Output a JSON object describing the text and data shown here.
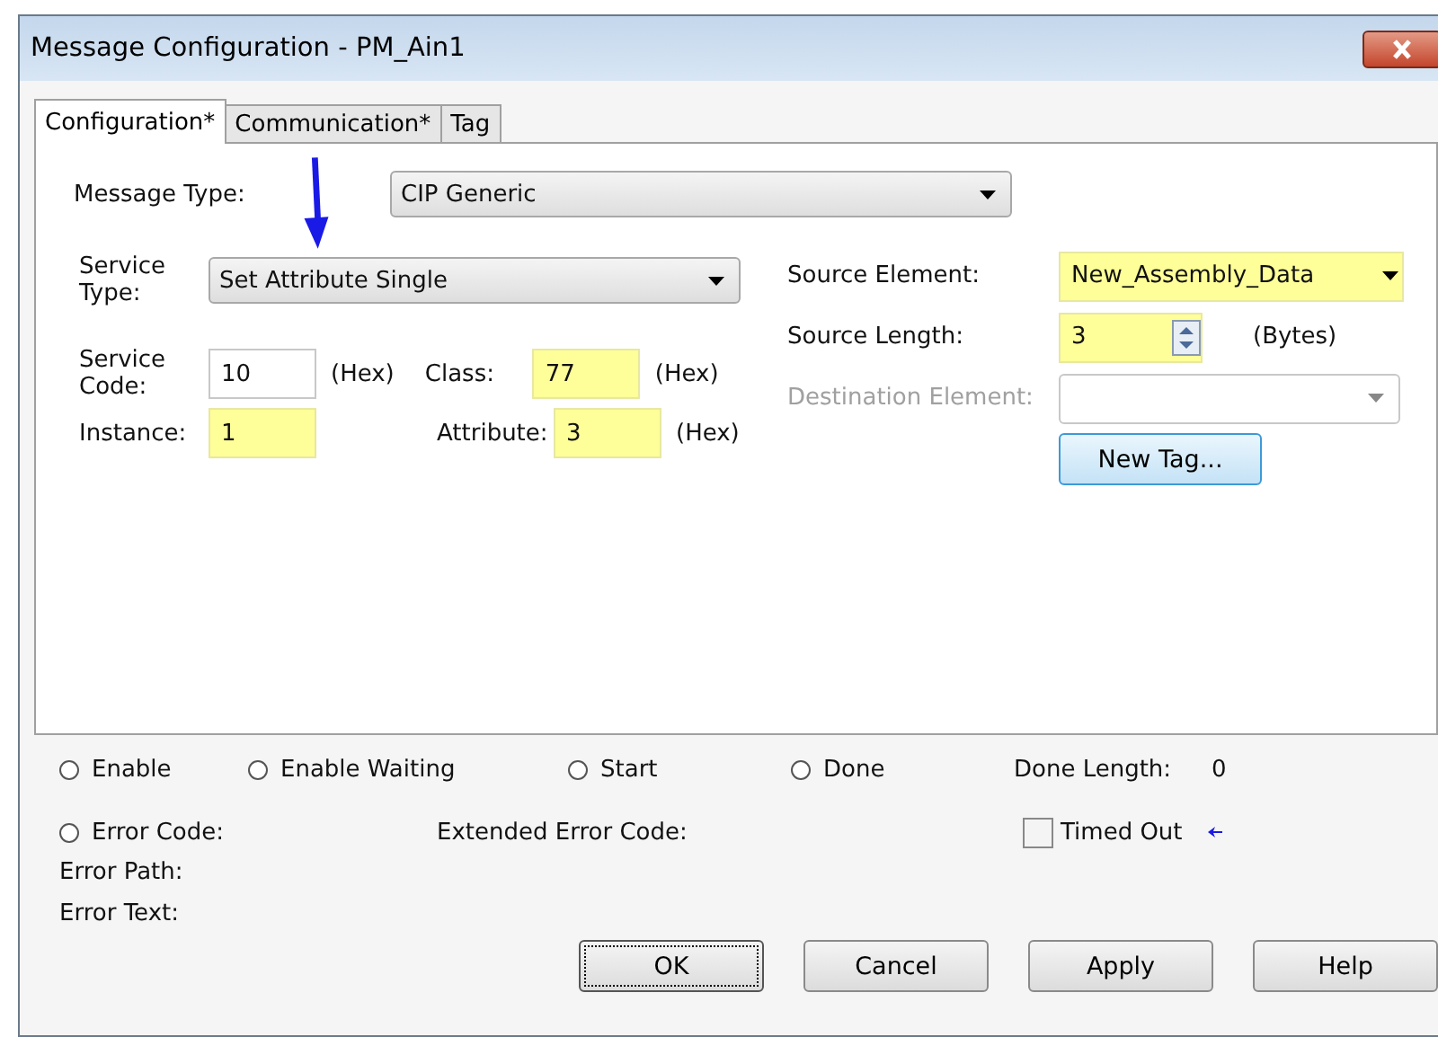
{
  "window": {
    "title": "Message Configuration - PM_Ain1"
  },
  "tabs": [
    {
      "label": "Configuration*",
      "selected": true
    },
    {
      "label": "Communication*",
      "selected": false
    },
    {
      "label": "Tag",
      "selected": false
    }
  ],
  "message_type": {
    "label": "Message Type:",
    "value": "CIP Generic"
  },
  "service_type": {
    "label": "Service Type:",
    "value": "Set Attribute Single"
  },
  "service_code": {
    "label": "Service Code:",
    "value": "10",
    "unit": "(Hex)",
    "highlighted": false
  },
  "class": {
    "label": "Class:",
    "value": "77",
    "unit": "(Hex)",
    "highlighted": true
  },
  "instance": {
    "label": "Instance:",
    "value": "1",
    "highlighted": true
  },
  "attribute": {
    "label": "Attribute:",
    "value": "3",
    "unit": "(Hex)",
    "highlighted": true
  },
  "source_element": {
    "label": "Source Element:",
    "value": "New_Assembly_Data",
    "highlighted": true
  },
  "source_length": {
    "label": "Source Length:",
    "value": "3",
    "unit": "(Bytes)",
    "highlighted": true
  },
  "destination_element": {
    "label": "Destination Element:",
    "disabled": true
  },
  "new_tag_button": "New Tag...",
  "statuses": [
    {
      "label": "Enable",
      "checked": false
    },
    {
      "label": "Enable Waiting",
      "checked": false
    },
    {
      "label": "Start",
      "checked": false
    },
    {
      "label": "Done",
      "checked": false
    }
  ],
  "done_length": {
    "label": "Done Length:",
    "value": "0"
  },
  "error_code": {
    "label": "Error Code:",
    "checked": false
  },
  "extended_error_code": {
    "label": "Extended Error Code:"
  },
  "timed_out": {
    "label": "Timed Out",
    "checked": false
  },
  "error_path": {
    "label": "Error Path:"
  },
  "error_text": {
    "label": "Error Text:"
  },
  "buttons": [
    {
      "label": "OK",
      "default": true
    },
    {
      "label": "Cancel",
      "default": false
    },
    {
      "label": "Apply",
      "default": false
    },
    {
      "label": "Help",
      "default": false
    }
  ]
}
